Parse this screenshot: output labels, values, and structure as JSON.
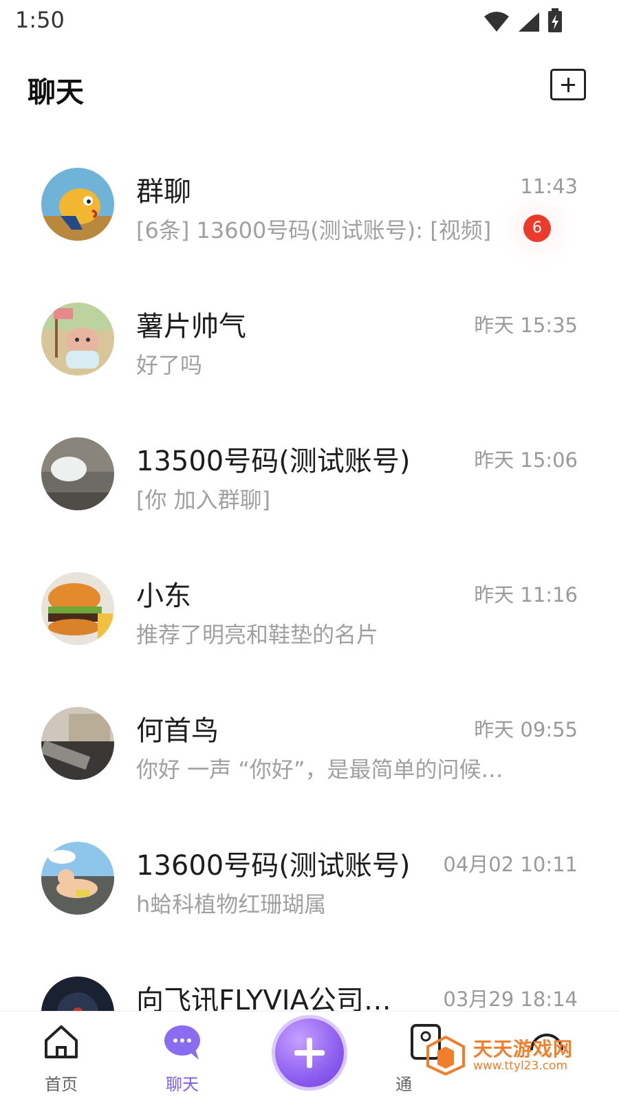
{
  "status_bar": {
    "time": "1:50"
  },
  "header": {
    "title": "聊天"
  },
  "chats": [
    {
      "name": "群聊",
      "time": "11:43",
      "preview": "[6条] 13600号码(测试账号): [视频]",
      "unread": "6"
    },
    {
      "name": "薯片帅气",
      "time": "昨天 15:35",
      "preview": "好了吗"
    },
    {
      "name": "13500号码(测试账号)",
      "time": "昨天 15:06",
      "preview": "[你 加入群聊]"
    },
    {
      "name": "小东",
      "time": "昨天 11:16",
      "preview": "推荐了明亮和鞋垫的名片"
    },
    {
      "name": "何首鸟",
      "time": "昨天 09:55",
      "preview": "你好 一声 “你好”，是最简单的问候…"
    },
    {
      "name": "13600号码(测试账号)",
      "time": "04月02 10:11",
      "preview": "h蛤科植物红珊瑚属"
    },
    {
      "name": "向飞讯FLYVIA公司…",
      "time": "03月29 18:14",
      "preview": ""
    }
  ],
  "bottom_nav": {
    "home": "首页",
    "chat": "聊天",
    "contacts": "通",
    "accent_color": "#7c5ce8"
  },
  "watermark": {
    "text": "天天游戏网",
    "url": "www.ttyl23.com"
  }
}
